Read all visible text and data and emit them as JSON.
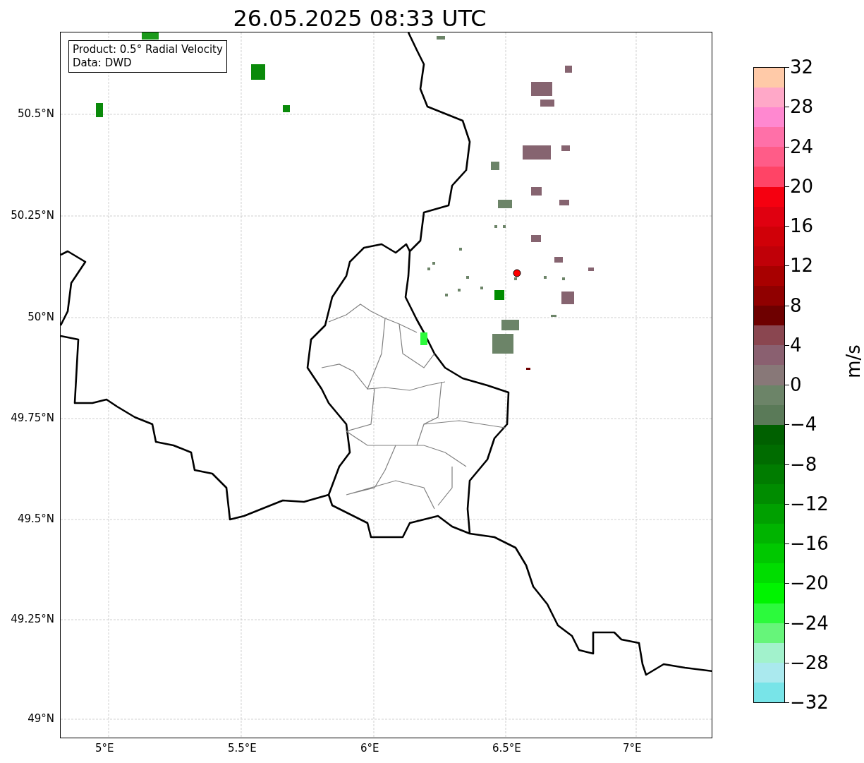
{
  "title": "26.05.2025 08:33 UTC",
  "info_box": {
    "lines": [
      "Product: 0.5° Radial Velocity",
      "Data: DWD"
    ]
  },
  "map": {
    "lat_labels": [
      "50.5°N",
      "50.25°N",
      "50°N",
      "49.75°N",
      "49.5°N",
      "49.25°N",
      "49°N"
    ],
    "lon_labels": [
      "5°E",
      "5.5°E",
      "6°E",
      "6.5°E",
      "7°E"
    ]
  },
  "colorbar": {
    "label": "m/s",
    "ticks": [
      "32",
      "28",
      "24",
      "20",
      "16",
      "12",
      "8",
      "4",
      "0",
      "−4",
      "−8",
      "−12",
      "−16",
      "−20",
      "−24",
      "−28",
      "−32"
    ]
  }
}
